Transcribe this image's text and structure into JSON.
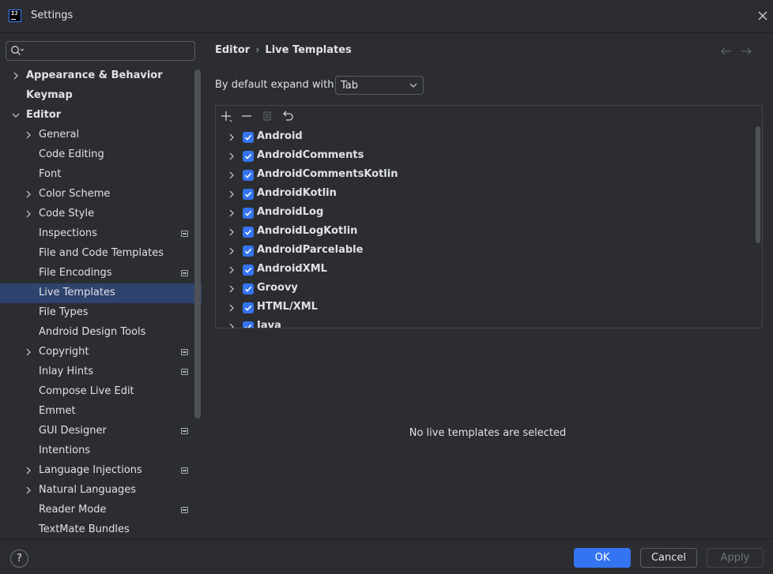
{
  "window": {
    "title": "Settings"
  },
  "search": {
    "placeholder": "",
    "value": ""
  },
  "sidebar": {
    "items": [
      {
        "label": "Appearance & Behavior",
        "level": 0,
        "expandable": true,
        "expanded": false,
        "badge": false,
        "selected": false
      },
      {
        "label": "Keymap",
        "level": 0,
        "expandable": false,
        "expanded": false,
        "badge": false,
        "selected": false
      },
      {
        "label": "Editor",
        "level": 0,
        "expandable": true,
        "expanded": true,
        "badge": false,
        "selected": false
      },
      {
        "label": "General",
        "level": 1,
        "expandable": true,
        "expanded": false,
        "badge": false,
        "selected": false
      },
      {
        "label": "Code Editing",
        "level": 1,
        "expandable": false,
        "expanded": false,
        "badge": false,
        "selected": false
      },
      {
        "label": "Font",
        "level": 1,
        "expandable": false,
        "expanded": false,
        "badge": false,
        "selected": false
      },
      {
        "label": "Color Scheme",
        "level": 1,
        "expandable": true,
        "expanded": false,
        "badge": false,
        "selected": false
      },
      {
        "label": "Code Style",
        "level": 1,
        "expandable": true,
        "expanded": false,
        "badge": false,
        "selected": false
      },
      {
        "label": "Inspections",
        "level": 1,
        "expandable": false,
        "expanded": false,
        "badge": true,
        "selected": false
      },
      {
        "label": "File and Code Templates",
        "level": 1,
        "expandable": false,
        "expanded": false,
        "badge": false,
        "selected": false
      },
      {
        "label": "File Encodings",
        "level": 1,
        "expandable": false,
        "expanded": false,
        "badge": true,
        "selected": false
      },
      {
        "label": "Live Templates",
        "level": 1,
        "expandable": false,
        "expanded": false,
        "badge": false,
        "selected": true
      },
      {
        "label": "File Types",
        "level": 1,
        "expandable": false,
        "expanded": false,
        "badge": false,
        "selected": false
      },
      {
        "label": "Android Design Tools",
        "level": 1,
        "expandable": false,
        "expanded": false,
        "badge": false,
        "selected": false
      },
      {
        "label": "Copyright",
        "level": 1,
        "expandable": true,
        "expanded": false,
        "badge": true,
        "selected": false
      },
      {
        "label": "Inlay Hints",
        "level": 1,
        "expandable": false,
        "expanded": false,
        "badge": true,
        "selected": false
      },
      {
        "label": "Compose Live Edit",
        "level": 1,
        "expandable": false,
        "expanded": false,
        "badge": false,
        "selected": false
      },
      {
        "label": "Emmet",
        "level": 1,
        "expandable": false,
        "expanded": false,
        "badge": false,
        "selected": false
      },
      {
        "label": "GUI Designer",
        "level": 1,
        "expandable": false,
        "expanded": false,
        "badge": true,
        "selected": false
      },
      {
        "label": "Intentions",
        "level": 1,
        "expandable": false,
        "expanded": false,
        "badge": false,
        "selected": false
      },
      {
        "label": "Language Injections",
        "level": 1,
        "expandable": true,
        "expanded": false,
        "badge": true,
        "selected": false
      },
      {
        "label": "Natural Languages",
        "level": 1,
        "expandable": true,
        "expanded": false,
        "badge": false,
        "selected": false
      },
      {
        "label": "Reader Mode",
        "level": 1,
        "expandable": false,
        "expanded": false,
        "badge": true,
        "selected": false
      },
      {
        "label": "TextMate Bundles",
        "level": 1,
        "expandable": false,
        "expanded": false,
        "badge": false,
        "selected": false
      }
    ]
  },
  "breadcrumb": {
    "parent": "Editor",
    "separator": "›",
    "current": "Live Templates"
  },
  "expand_setting": {
    "label": "By default expand with",
    "value": "Tab"
  },
  "templates": {
    "groups": [
      {
        "name": "Android",
        "checked": true
      },
      {
        "name": "AndroidComments",
        "checked": true
      },
      {
        "name": "AndroidCommentsKotlin",
        "checked": true
      },
      {
        "name": "AndroidKotlin",
        "checked": true
      },
      {
        "name": "AndroidLog",
        "checked": true
      },
      {
        "name": "AndroidLogKotlin",
        "checked": true
      },
      {
        "name": "AndroidParcelable",
        "checked": true
      },
      {
        "name": "AndroidXML",
        "checked": true
      },
      {
        "name": "Groovy",
        "checked": true
      },
      {
        "name": "HTML/XML",
        "checked": true
      },
      {
        "name": "Java",
        "checked": true
      }
    ],
    "empty_message": "No live templates are selected"
  },
  "footer": {
    "help_label": "?",
    "ok_label": "OK",
    "cancel_label": "Cancel",
    "apply_label": "Apply"
  },
  "colors": {
    "accent": "#3574f0",
    "selection": "#2e436e",
    "background": "#2b2d30"
  }
}
